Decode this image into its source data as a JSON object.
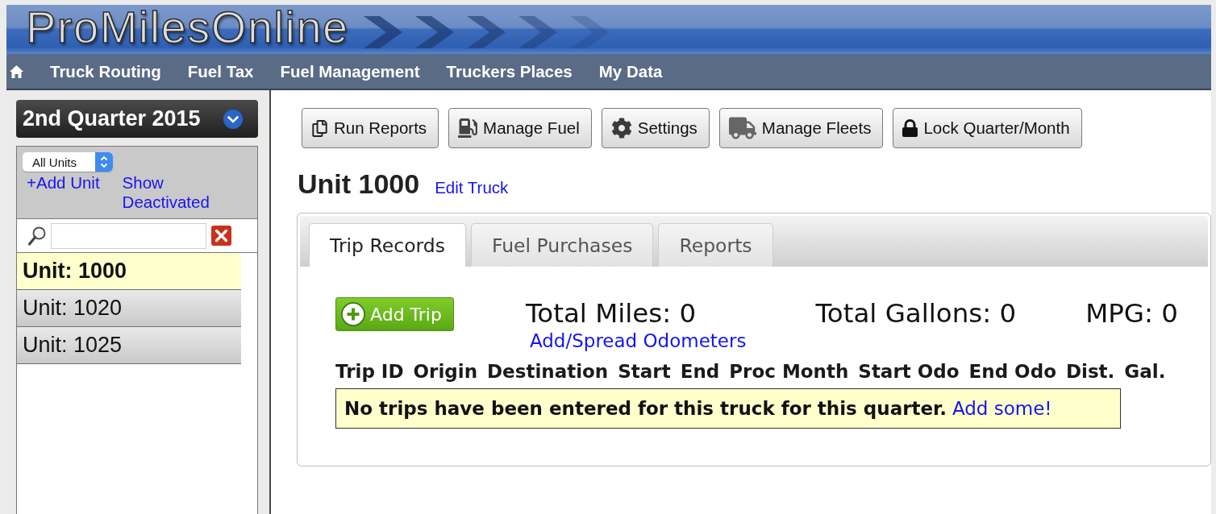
{
  "header": {
    "logo": "ProMilesOnline"
  },
  "nav": {
    "items": [
      "Truck Routing",
      "Fuel Tax",
      "Fuel Management",
      "Truckers Places",
      "My Data"
    ]
  },
  "sidebar": {
    "quarter": "2nd Quarter 2015",
    "unit_filter": {
      "value": "All Units"
    },
    "links": [
      "+Add Unit",
      "Show Deactivated"
    ],
    "units": [
      {
        "label": "Unit: 1000",
        "selected": true
      },
      {
        "label": "Unit: 1020",
        "selected": false
      },
      {
        "label": "Unit: 1025",
        "selected": false
      }
    ]
  },
  "toolbar": {
    "buttons": [
      "Run Reports",
      "Manage Fuel",
      "Settings",
      "Manage Fleets",
      "Lock Quarter/Month"
    ]
  },
  "unit": {
    "title": "Unit 1000",
    "edit_link": "Edit Truck"
  },
  "tabs": [
    {
      "label": "Trip Records",
      "selected": true
    },
    {
      "label": "Fuel Purchases",
      "selected": false
    },
    {
      "label": "Reports",
      "selected": false
    }
  ],
  "trip_records": {
    "add_button": "Add Trip",
    "totals": [
      "Total Miles: 0",
      "Total Gallons: 0",
      "MPG: 0"
    ],
    "odometer_link": "Add/Spread Odometers",
    "columns": [
      "Trip ID",
      "Origin",
      "Destination",
      "Start",
      "End",
      "Proc Month",
      "Start Odo",
      "End Odo",
      "Dist.",
      "Gal."
    ],
    "empty_message": "No trips have been entered for this truck for this quarter.",
    "empty_link": "Add some!"
  }
}
